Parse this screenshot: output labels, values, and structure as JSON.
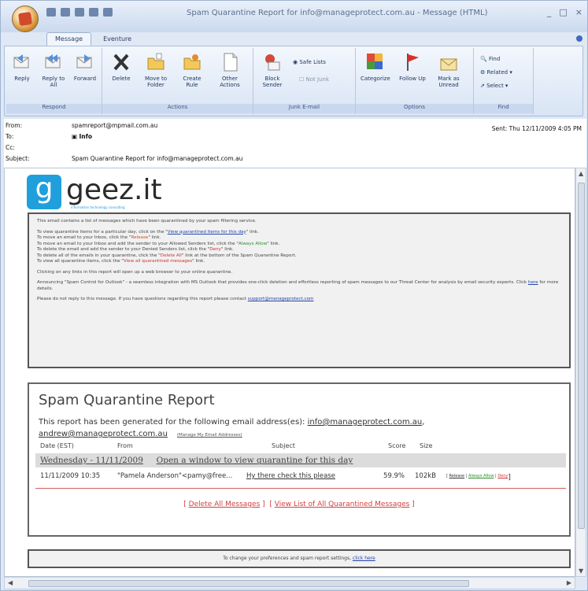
{
  "window": {
    "title": "Spam Quarantine Report for info@manageprotect.com.au - Message (HTML)",
    "controls": [
      "_",
      "□",
      "×"
    ]
  },
  "tabs": [
    {
      "label": "Message",
      "active": true
    },
    {
      "label": "Eventure",
      "active": false
    }
  ],
  "ribbon": {
    "respond": {
      "label": "Respond",
      "buttons": [
        "Reply",
        "Reply to All",
        "Forward"
      ]
    },
    "actions": {
      "label": "Actions",
      "buttons": [
        "Delete",
        "Move to Folder",
        "Create Rule",
        "Other Actions"
      ]
    },
    "junk": {
      "label": "Junk E-mail",
      "buttons": [
        "Block Sender"
      ],
      "small": [
        "Safe Lists",
        "Not Junk"
      ]
    },
    "options": {
      "label": "Options",
      "buttons": [
        "Categorize",
        "Follow Up",
        "Mark as Unread"
      ]
    },
    "find": {
      "label": "Find",
      "small": [
        "Find",
        "Related",
        "Select"
      ]
    }
  },
  "header": {
    "from_label": "From:",
    "from_value": "spamreport@mpmail.com.au",
    "to_label": "To:",
    "to_value": "Info",
    "cc_label": "Cc:",
    "subject_label": "Subject:",
    "subject_value": "Spam Quarantine Report for info@manageprotect.com.au",
    "sent": "Sent:   Thu 12/11/2009 4:05 PM"
  },
  "logo": {
    "letter": "g",
    "text": "geez.it",
    "tagline": "information technology consulting"
  },
  "info": {
    "intro": "This email contains a list of messages which have been quarantined by your spam filtering service.",
    "line1_a": "To view quarantine items for a particular day, click on the \"",
    "line1_link": "View quarantined items for this day",
    "line1_b": "\" link.",
    "line2_a": "To move an email to your Inbox, click the \"",
    "line2_link": "Release",
    "line2_b": "\" link.",
    "line3_a": "To move an email to your Inbox and add the sender to your Allowed Senders list, click the \"",
    "line3_link": "Always Allow",
    "line3_b": "\" link.",
    "line4_a": "To delete the email and add the sender to your Denied Senders list, click the \"",
    "line4_link": "Deny",
    "line4_b": "\" link.",
    "line5_a": "To delete all of the emails in your quarantine, click the \"",
    "line5_link": "Delete All",
    "line5_b": "\" link at the bottom of the Spam Quarantine Report.",
    "line6_a": "To view all quarantine items, click the \"",
    "line6_link": "View all quarantined messages",
    "line6_b": "\" link.",
    "clicking": "Clicking on any links in this report will open up a web browser to your online quarantine.",
    "announce_a": "Announcing \"Spam Control for Outlook\" - a seamless integration with MS Outlook that provides one-click deletion and effortless reporting of spam messages to our Threat Center for analysis by email security experts. Click ",
    "announce_link": "here",
    "announce_b": " for more details.",
    "noreply_a": "Please do not reply to this message. If you have questions regarding this report please contact ",
    "noreply_link": "support@manageprotect.com"
  },
  "report": {
    "title": "Spam Quarantine Report",
    "generated_a": "This report has been generated for the following email address(es): ",
    "generated_link1": "info@manageprotect.com.au",
    "generated_sep": ",",
    "generated_link2": "andrew@manageprotect.com.au",
    "manage_link": "(Manage My Email Addresses)",
    "columns": [
      "Date (EST)",
      "From",
      "Subject",
      "Score",
      "Size"
    ],
    "day_label": "Wednesday - 11/11/2009",
    "day_link": "Open a window to view quarantine for this day",
    "row": {
      "date": "11/11/2009 10:35",
      "from": "\"Pamela Anderson\"<pamy@free...",
      "subject": "Hy there check this please",
      "score": "59.9%",
      "size": "102kB",
      "release": "Release",
      "allow": "Always Allow",
      "deny": "Deny"
    },
    "delete_all": "Delete All Messages",
    "view_list": "View List of All Quarantined Messages"
  },
  "prefs": {
    "text": "To change your preferences and spam report settings, ",
    "link": "click here"
  },
  "colors": {
    "logo_blue": "#1fa0dc",
    "always_allow": "#2b8d2b",
    "release": "#d0501c",
    "deny": "#d03030",
    "action_links": "#d04040"
  }
}
